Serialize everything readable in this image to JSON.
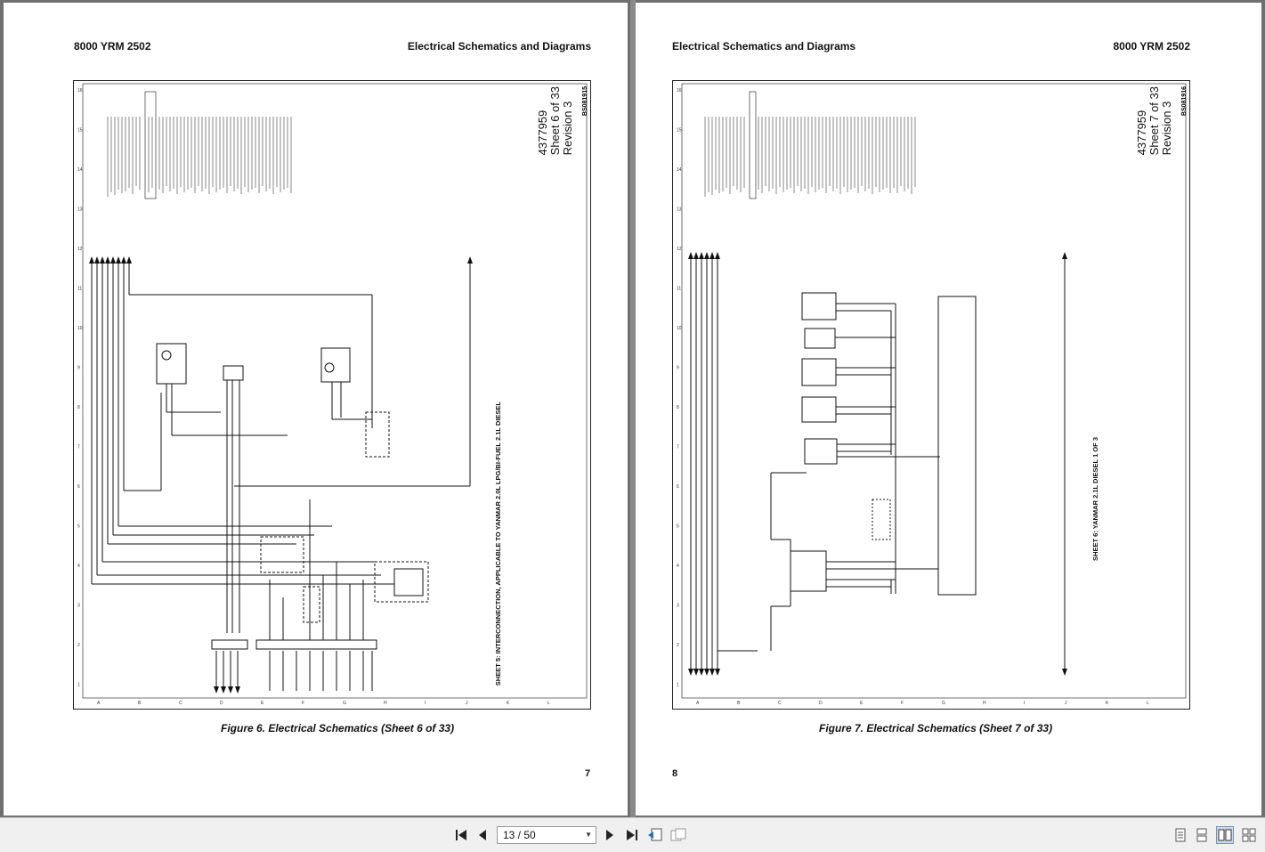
{
  "viewer": {
    "page_indicator": "13 / 50",
    "icons": [
      "first-page-icon",
      "prev-page-icon",
      "next-page-icon",
      "last-page-icon",
      "extract-page-icon",
      "rotate-page-icon",
      "single-page-view-icon",
      "continuous-view-icon",
      "two-page-view-icon",
      "two-page-continuous-view-icon"
    ]
  },
  "left_page": {
    "header_left": "8000 YRM 2502",
    "header_right": "Electrical Schematics and Diagrams",
    "sheet_number": "4377959",
    "sheet_of": "Sheet 6 of 33",
    "revision": "Revision 3",
    "sheet_code": "BS081915",
    "sheet_title": "SHEET 5: INTERCONNECTION, APPLICABLE TO YANMAR 2.0L LPG/BI-FUEL 2.1L DIESEL",
    "caption": "Figure 6. Electrical Schematics (Sheet 6 of 33)",
    "page_number": "7"
  },
  "right_page": {
    "header_left": "Electrical Schematics and Diagrams",
    "header_right": "8000 YRM 2502",
    "sheet_number": "4377959",
    "sheet_of": "Sheet 7 of 33",
    "revision": "Revision 3",
    "sheet_code": "BS081916",
    "sheet_title": "SHEET 6: YANMAR 2.1L DIESEL 1 OF 3",
    "caption": "Figure 7. Electrical Schematics (Sheet 7 of 33)",
    "page_number": "8"
  },
  "grid": {
    "rows": [
      "16",
      "15",
      "14",
      "13",
      "12",
      "11",
      "10",
      "9",
      "8",
      "7",
      "6",
      "5",
      "4",
      "3",
      "2",
      "1"
    ],
    "cols": [
      "A",
      "B",
      "C",
      "D",
      "E",
      "F",
      "G",
      "H",
      "I",
      "J",
      "K",
      "L"
    ]
  },
  "colors": {
    "background": "#6f6f6f",
    "page": "#ffffff",
    "toolbar": "#f0f0f0",
    "ink": "#111111"
  }
}
